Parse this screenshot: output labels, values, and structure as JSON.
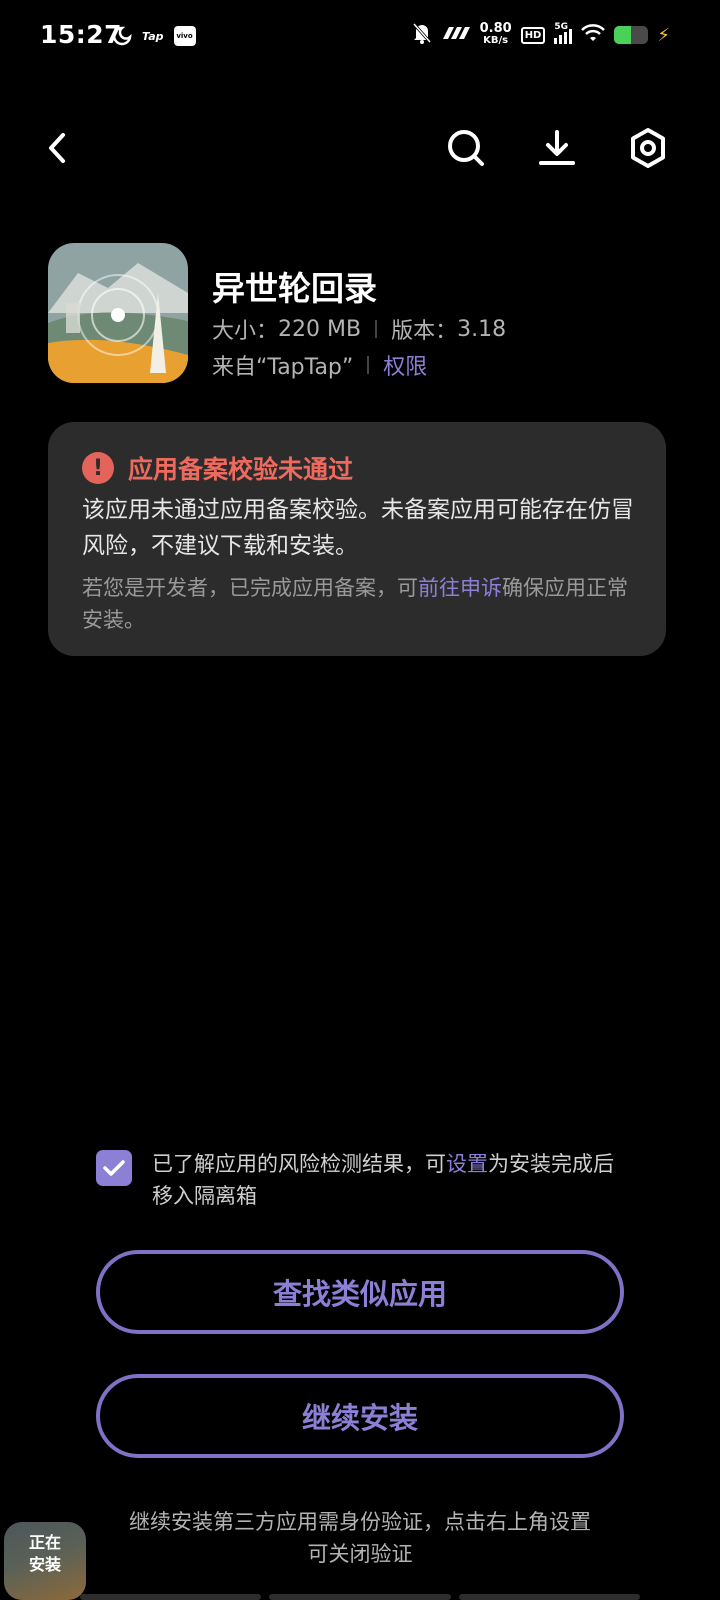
{
  "status_bar": {
    "time": "15:27",
    "left_icons": [
      "moon-icon",
      "taptap-icon",
      "vivo-icon"
    ],
    "tap_label": "Tap",
    "vivo_label": "vivo",
    "net_speed_value": "0.80",
    "net_speed_unit": "KB/s",
    "hd_label": "HD",
    "network_label": "5G",
    "battery_level": 0.5
  },
  "nav": {
    "icons": [
      "back-icon",
      "search-icon",
      "download-icon",
      "settings-icon"
    ]
  },
  "app": {
    "name": "异世轮回录",
    "size_label": "大小：",
    "size_value": "220 MB",
    "version_label": "版本：",
    "version_value": "3.18",
    "source": "来自“TapTap”",
    "permissions_link": "权限"
  },
  "warning": {
    "title": "应用备案校验未通过",
    "body": "该应用未通过应用备案校验。未备案应用可能存在仿冒风险，不建议下载和安装。",
    "note_prefix": "若您是开发者，已完成应用备案，可",
    "note_link": "前往申诉",
    "note_suffix": "确保应用正常安装。",
    "color": "#ee6a5f"
  },
  "consent": {
    "checked": true,
    "text_prefix": "已了解应用的风险检测结果，可",
    "text_link": "设置",
    "text_suffix": "为安装完成后移入隔离箱"
  },
  "buttons": {
    "find_similar": "查找类似应用",
    "continue_install": "继续安装"
  },
  "footer_note": "继续安装第三方应用需身份验证，点击右上角设置可关闭验证",
  "installing_bubble": {
    "line1": "正在",
    "line2": "安装"
  },
  "colors": {
    "accent": "#8c80d6",
    "background": "#000000",
    "card": "#2c2c2c"
  }
}
